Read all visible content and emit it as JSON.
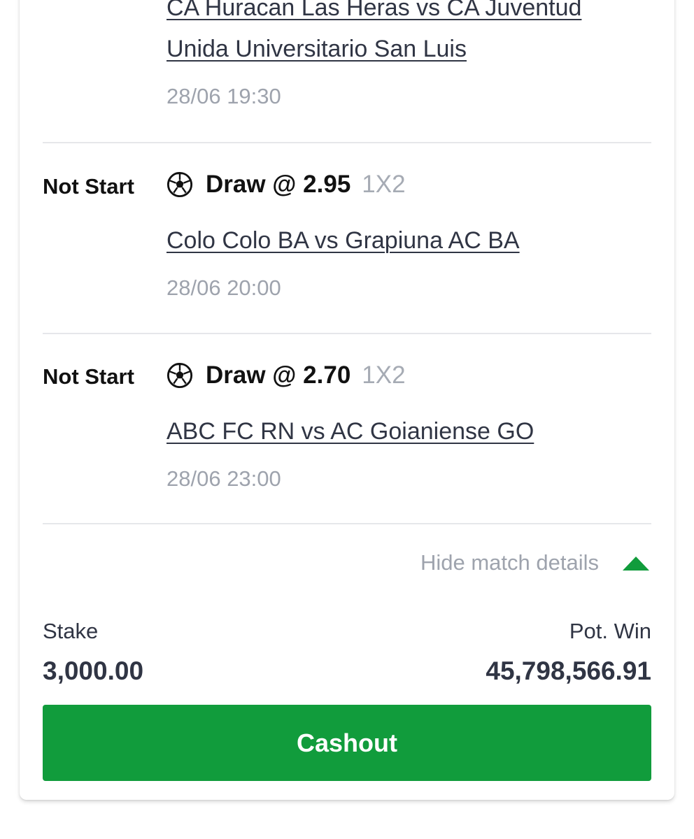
{
  "bets": [
    {
      "status": "",
      "pick": "",
      "odds": "",
      "market": "",
      "match_line1": "CA Huracan Las Heras vs CA Juventud",
      "match_line2": "Unida Universitario San Luis",
      "datetime": "28/06 19:30"
    },
    {
      "status": "Not Start",
      "pick": "Draw @ 2.95",
      "market": "1X2",
      "sport_icon": "soccer-ball-icon",
      "match": "Colo Colo BA vs Grapiuna AC BA",
      "datetime": "28/06 20:00"
    },
    {
      "status": "Not Start",
      "pick": "Draw @ 2.70",
      "market": "1X2",
      "sport_icon": "soccer-ball-icon",
      "match": "ABC FC RN vs AC Goianiense GO",
      "datetime": "28/06 23:00"
    }
  ],
  "details_toggle": {
    "label": "Hide match details",
    "icon": "caret-up-icon"
  },
  "summary": {
    "stake_label": "Stake",
    "stake_value": "3,000.00",
    "pot_win_label": "Pot. Win",
    "pot_win_value": "45,798,566.91"
  },
  "cashout_button": {
    "label": "Cashout"
  },
  "colors": {
    "accent_green": "#119c3c",
    "text_dark": "#303544",
    "text_muted": "#9ea3ad",
    "divider": "#e6e7ea"
  }
}
